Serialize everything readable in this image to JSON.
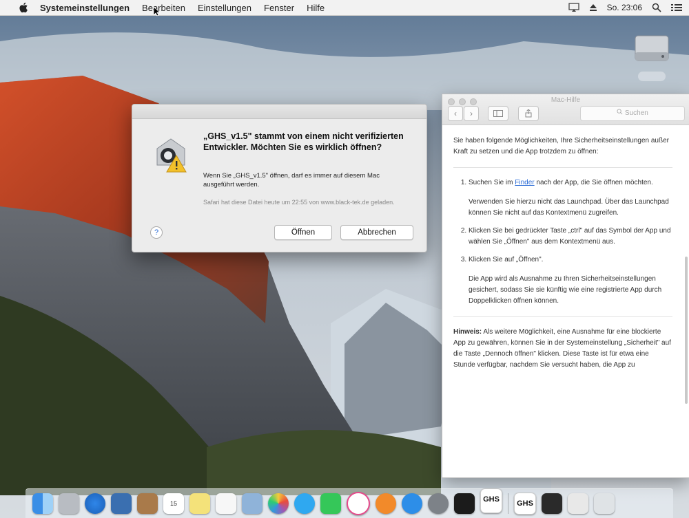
{
  "menubar": {
    "app_name": "Systemeinstellungen",
    "items": [
      "Bearbeiten",
      "Einstellungen",
      "Fenster",
      "Hilfe"
    ],
    "clock": "So. 23:06"
  },
  "alert": {
    "heading": "„GHS_v1.5\" stammt von einem nicht verifizierten Entwickler. Möchten Sie es wirklich öffnen?",
    "info": "Wenn Sie „GHS_v1.5\" öffnen, darf es immer auf diesem Mac ausgeführt werden.",
    "source": "Safari hat diese Datei heute um 22:55 von www.black-tek.de geladen.",
    "open_label": "Öffnen",
    "cancel_label": "Abbrechen",
    "help_label": "?"
  },
  "helpwin": {
    "title": "Mac-Hilfe",
    "search_placeholder": "Suchen",
    "intro": "Sie haben folgende Möglichkeiten, Ihre Sicherheitseinstellungen außer Kraft zu setzen und die App trotzdem zu öffnen:",
    "step1_pre": "Suchen Sie im ",
    "step1_link": "Finder",
    "step1_post": " nach der App, die Sie öffnen möchten.",
    "step1_sub": "Verwenden Sie hierzu nicht das Launchpad. Über das Launchpad können Sie nicht auf das Kontextmenü zugreifen.",
    "step2": "Klicken Sie bei gedrückter Taste „ctrl\" auf das Symbol der App und wählen Sie „Öffnen\" aus dem Kontextmenü aus.",
    "step3": "Klicken Sie auf „Öffnen\".",
    "step3_sub": "Die App wird als Ausnahme zu Ihren Sicherheitseinstellungen gesichert, sodass Sie sie künftig wie eine registrierte App durch Doppelklicken öffnen können.",
    "note_label": "Hinweis:",
    "note_text": " Als weitere Möglichkeit, eine Ausnahme für eine blockierte App zu gewähren, können Sie in der Systemeinstellung „Sicherheit\" auf die Taste „Dennoch öffnen\" klicken. Diese Taste ist für etwa eine Stunde verfügbar, nachdem Sie versucht haben, die App zu"
  },
  "dock": {
    "calendar_day": "15",
    "ghs_label": "GHS",
    "ghs_label2": "GHS"
  },
  "colors": {
    "link": "#2a6bd6",
    "menubar": "#f2f2f2"
  }
}
